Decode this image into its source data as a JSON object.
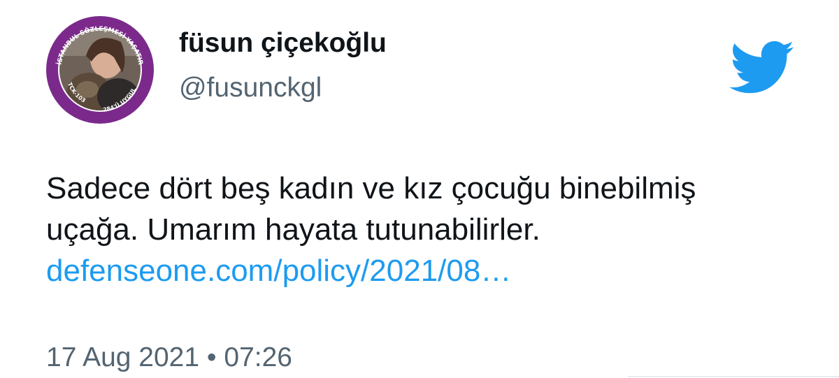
{
  "author": {
    "display_name": "füsun çiçekoğlu",
    "handle": "@fusunckgl",
    "avatar": {
      "icon": "avatar-icon",
      "ring_color": "#7b2a8c",
      "ring_text_top": "İSTANBUL SÖZLEŞMESİ YAŞATIR",
      "ring_text_left": "TCK-103",
      "ring_text_right": "6284'Ü UYGULA"
    }
  },
  "brand": {
    "icon": "twitter-bird-icon",
    "color": "#1d9bf0"
  },
  "tweet": {
    "text": "Sadece dört beş kadın ve kız çocuğu binebilmiş\nuçağa. Umarım hayata tutunabilirler.",
    "link": "defenseone.com/policy/2021/08…",
    "timestamp": "17 Aug 2021 • 07:26"
  }
}
